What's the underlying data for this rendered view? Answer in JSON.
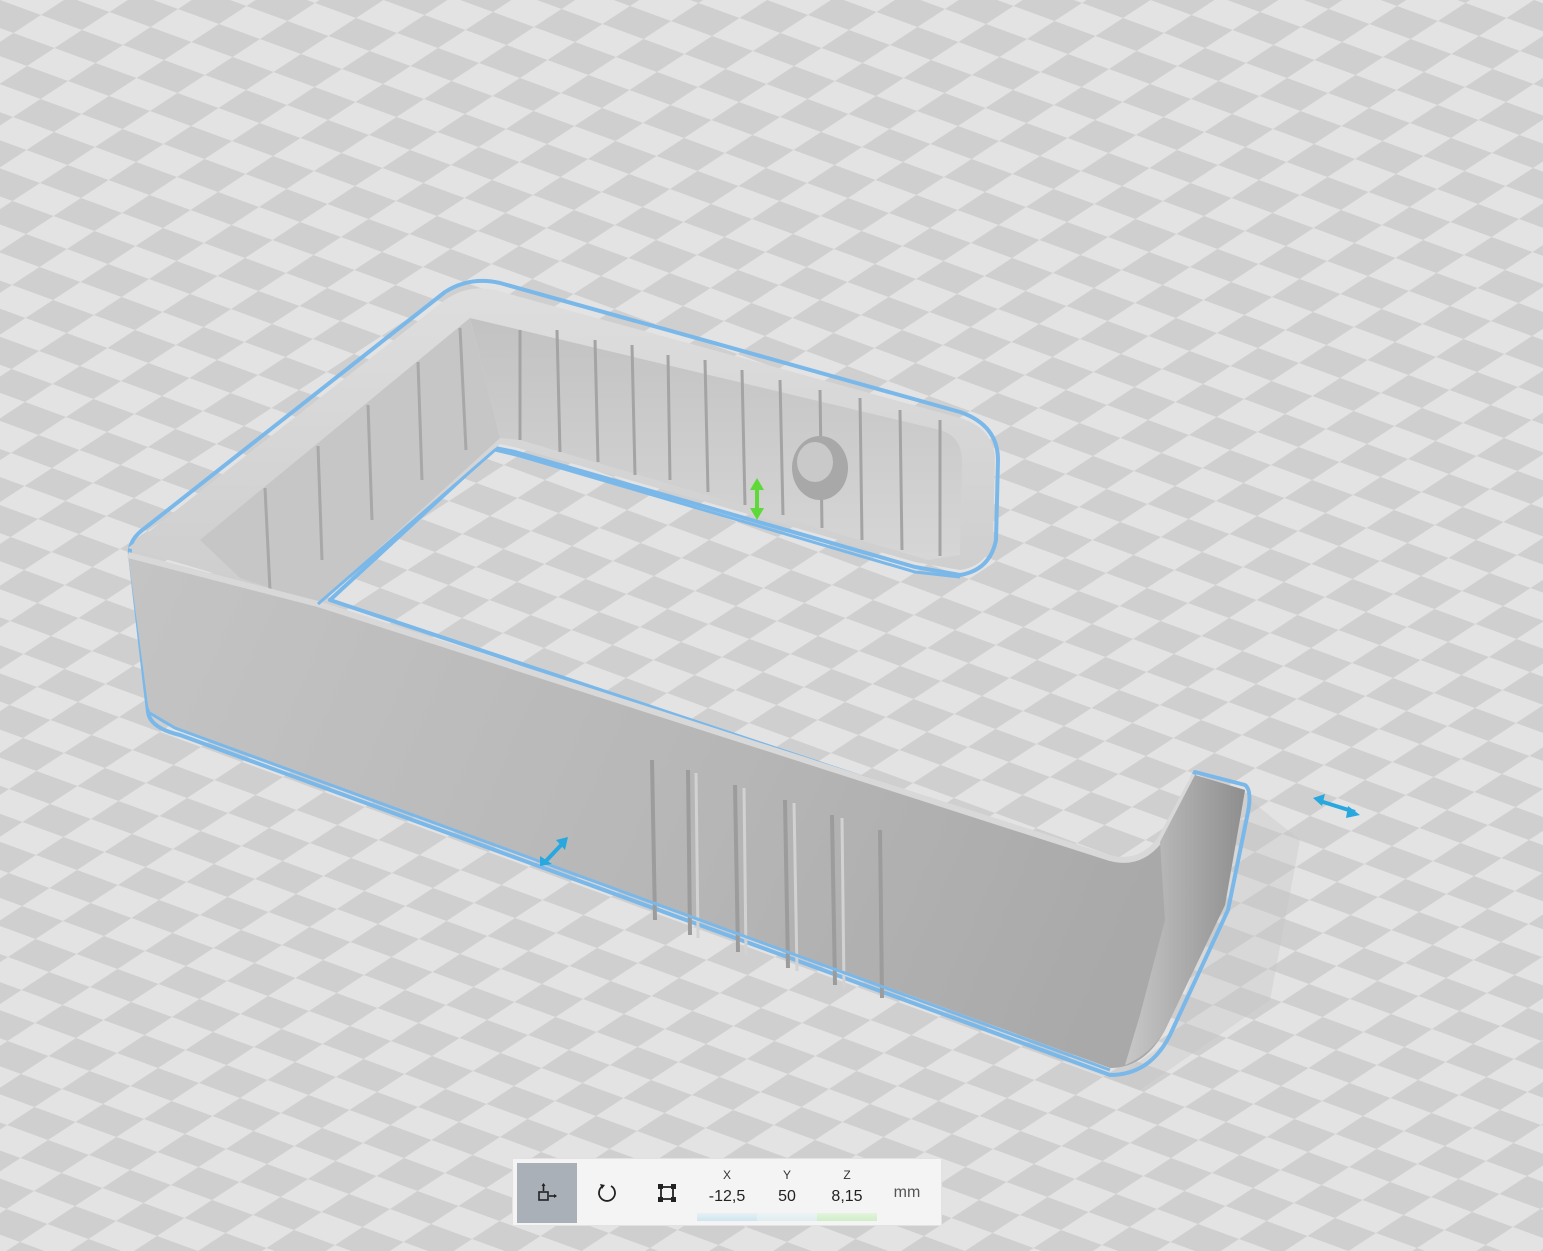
{
  "toolbar": {
    "tools": [
      {
        "name": "move",
        "icon": "move-icon",
        "active": true
      },
      {
        "name": "rotate",
        "icon": "rotate-icon",
        "active": false
      },
      {
        "name": "scale",
        "icon": "scale-icon",
        "active": false
      }
    ],
    "coordinates": {
      "x": {
        "label": "X",
        "value": "-12,5"
      },
      "y": {
        "label": "Y",
        "value": "50"
      },
      "z": {
        "label": "Z",
        "value": "8,15"
      }
    },
    "unit": "mm"
  },
  "colors": {
    "build_plate_light": "#e3e3e3",
    "build_plate_dark": "#cfcfcf",
    "model": "#b9b9b9",
    "selection_outline": "#7ab8ea",
    "gizmo_xy": "#29a8e0",
    "gizmo_z": "#5fd83a",
    "active_tool": "#a9b0b7"
  }
}
